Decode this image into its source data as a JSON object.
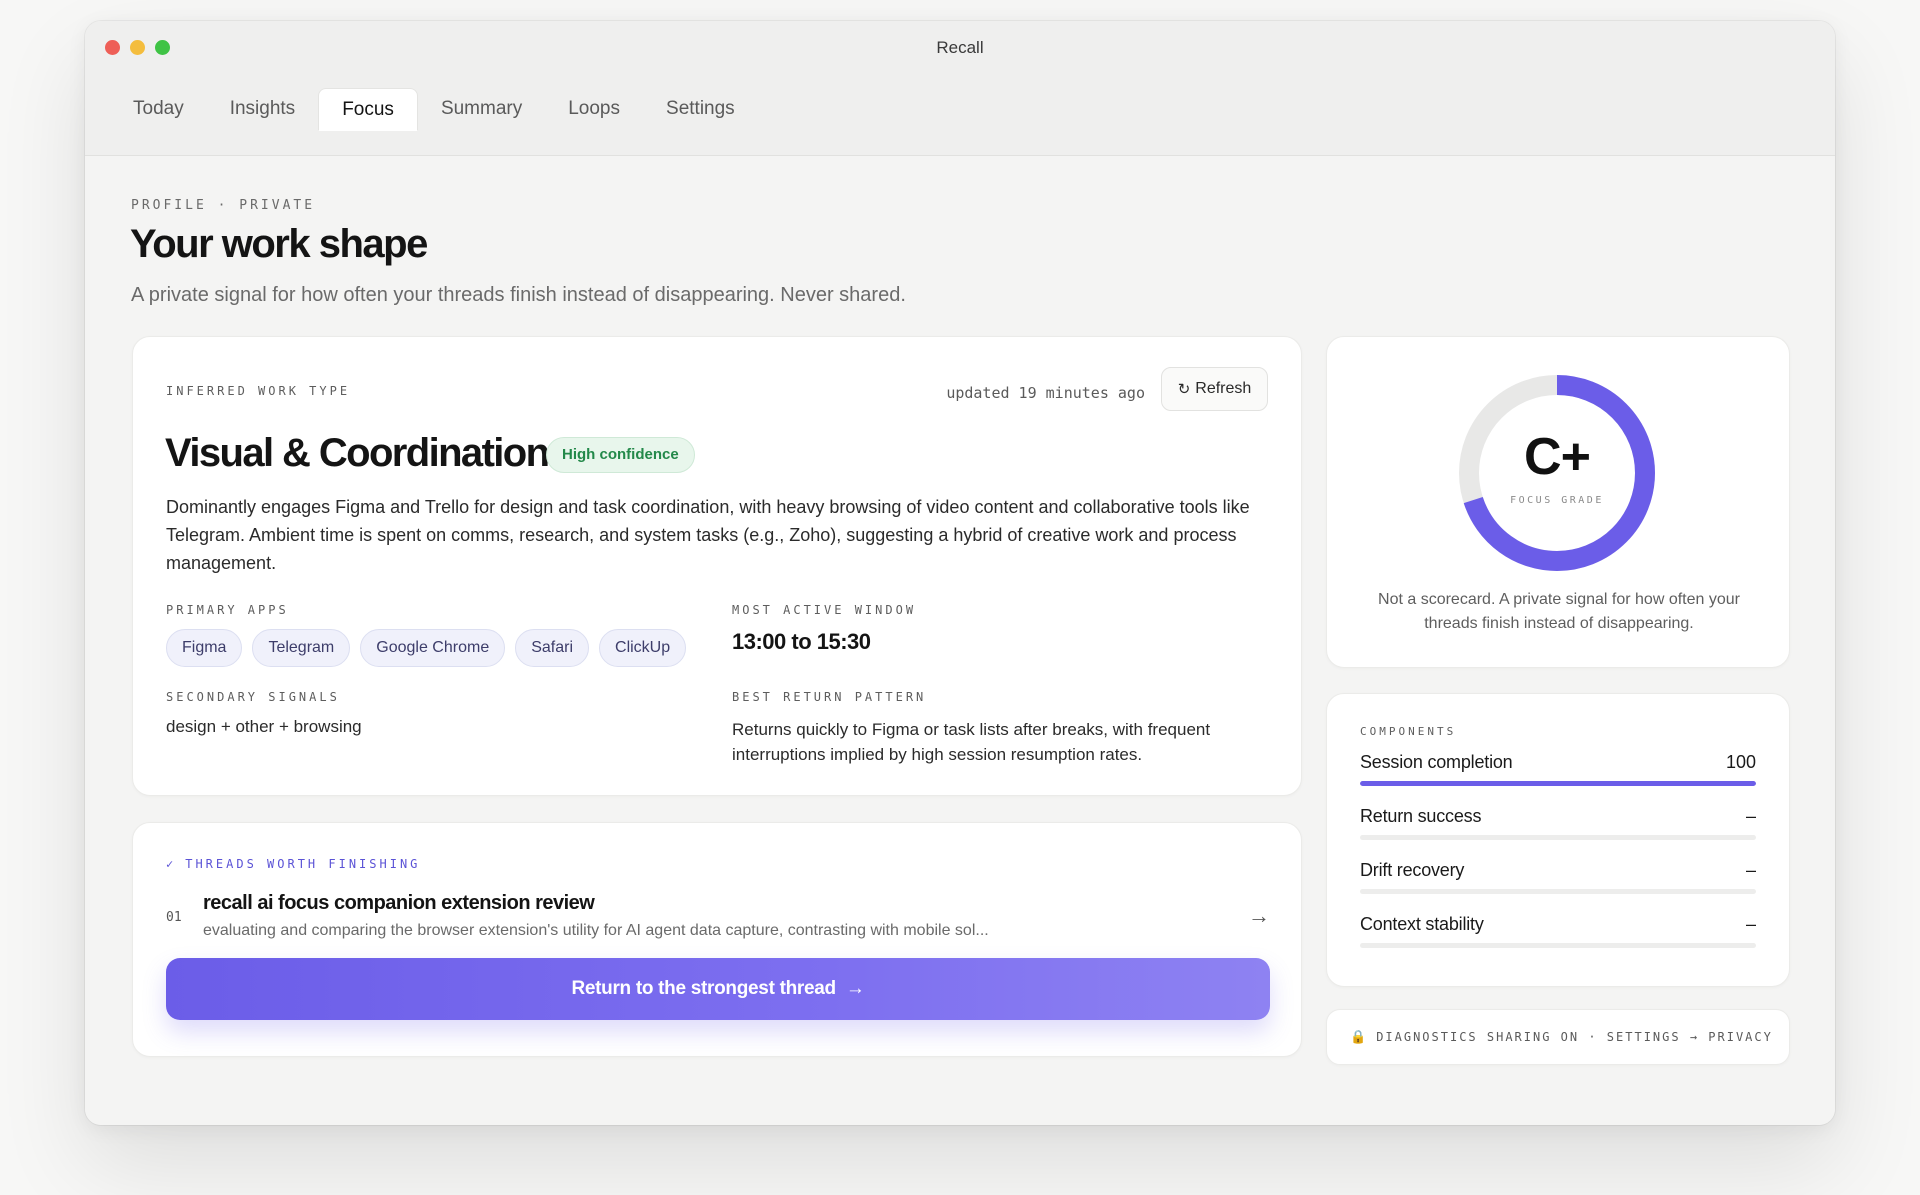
{
  "window": {
    "title": "Recall"
  },
  "tabs": [
    {
      "label": "Today",
      "active": false
    },
    {
      "label": "Insights",
      "active": false
    },
    {
      "label": "Focus",
      "active": true
    },
    {
      "label": "Summary",
      "active": false
    },
    {
      "label": "Loops",
      "active": false
    },
    {
      "label": "Settings",
      "active": false
    }
  ],
  "header": {
    "eyebrow": "PROFILE · PRIVATE",
    "title": "Your work shape",
    "subtitle": "A private signal for how often your threads finish instead of disappearing. Never shared."
  },
  "work_type": {
    "eyebrow": "INFERRED WORK TYPE",
    "updated": "updated 19 minutes ago",
    "refresh_label": "Refresh",
    "refresh_icon": "refresh-icon",
    "title": "Visual & Coordination",
    "confidence": "High confidence",
    "description": "Dominantly engages Figma and Trello for design and task coordination, with heavy browsing of video content and collaborative tools like Telegram. Ambient time is spent on comms, research, and system tasks (e.g., Zoho), suggesting a hybrid of creative work and process management.",
    "primary_apps_label": "PRIMARY APPS",
    "primary_apps": [
      "Figma",
      "Telegram",
      "Google Chrome",
      "Safari",
      "ClickUp"
    ],
    "most_active_label": "MOST ACTIVE WINDOW",
    "most_active": "13:00 to 15:30",
    "secondary_label": "SECONDARY SIGNALS",
    "secondary": "design + other + browsing",
    "return_label": "BEST RETURN PATTERN",
    "return_pattern": "Returns quickly to Figma or task lists after breaks, with frequent interruptions implied by high session resumption rates."
  },
  "grade": {
    "letter": "C+",
    "label": "FOCUS GRADE",
    "ring_fraction": 0.7,
    "ring_color": "#6b5de8",
    "note": "Not a scorecard. A private signal for how often your threads finish instead of disappearing."
  },
  "threads": {
    "eyebrow": "THREADS WORTH FINISHING",
    "check_icon": "check-icon",
    "items": [
      {
        "num": "01",
        "title": "recall ai focus companion extension review",
        "description": "evaluating and comparing the browser extension's utility for AI agent data capture, contrasting with mobile sol...",
        "arrow": "→"
      }
    ],
    "cta": "Return to the strongest thread",
    "cta_arrow": "→"
  },
  "components": {
    "eyebrow": "COMPONENTS",
    "items": [
      {
        "name": "Session completion",
        "value": "100",
        "fraction": 1.0
      },
      {
        "name": "Return success",
        "value": "–",
        "fraction": 0
      },
      {
        "name": "Drift recovery",
        "value": "–",
        "fraction": 0
      },
      {
        "name": "Context stability",
        "value": "–",
        "fraction": 0
      }
    ]
  },
  "diagnostics": {
    "icon": "lock-icon",
    "text": "DIAGNOSTICS SHARING ON · SETTINGS → PRIVACY"
  }
}
